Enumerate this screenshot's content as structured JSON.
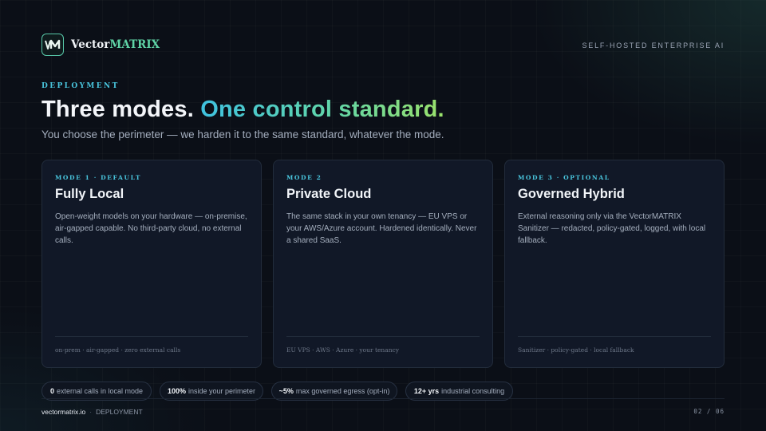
{
  "header": {
    "brand_prefix": "Vector",
    "brand_accent": "MATRIX",
    "tagline": "SELF-HOSTED ENTERPRISE AI",
    "logo_icon": "vm-monogram-icon"
  },
  "hero": {
    "eyebrow": "DEPLOYMENT",
    "headline_main": "Three modes.",
    "headline_accent": "One control standard.",
    "subhead": "You choose the perimeter — we harden it to the same standard, whatever the mode."
  },
  "cards": [
    {
      "mode": "MODE 1 · DEFAULT",
      "title": "Fully Local",
      "body": "Open-weight models on your hardware — on-premise, air-gapped capable. No third-party cloud, no external calls.",
      "footer": "on-prem · air-gapped · zero external calls"
    },
    {
      "mode": "MODE 2",
      "title": "Private Cloud",
      "body": "The same stack in your own tenancy — EU VPS or your AWS/Azure account. Hardened identically. Never a shared SaaS.",
      "footer": "EU VPS · AWS · Azure · your tenancy"
    },
    {
      "mode": "MODE 3 · OPTIONAL",
      "title": "Governed Hybrid",
      "body": "External reasoning only via the VectorMATRIX Sanitizer — redacted, policy-gated, logged, with local fallback.",
      "footer": "Sanitizer · policy-gated · local fallback"
    }
  ],
  "stats": [
    {
      "value": "0",
      "label": "external calls in local mode"
    },
    {
      "value": "100%",
      "label": "inside your perimeter"
    },
    {
      "value": "~5%",
      "label": "max governed egress (opt-in)"
    },
    {
      "value": "12+ yrs",
      "label": "industrial consulting"
    }
  ],
  "footer": {
    "site": "vectormatrix.io",
    "separator": "·",
    "section": "DEPLOYMENT",
    "page": "02 / 06"
  },
  "colors": {
    "background": "#0b0f17",
    "card": "#111827",
    "accent_cyan": "#49c6de",
    "accent_green": "#62d6a8",
    "accent_lime": "#9be26a"
  }
}
